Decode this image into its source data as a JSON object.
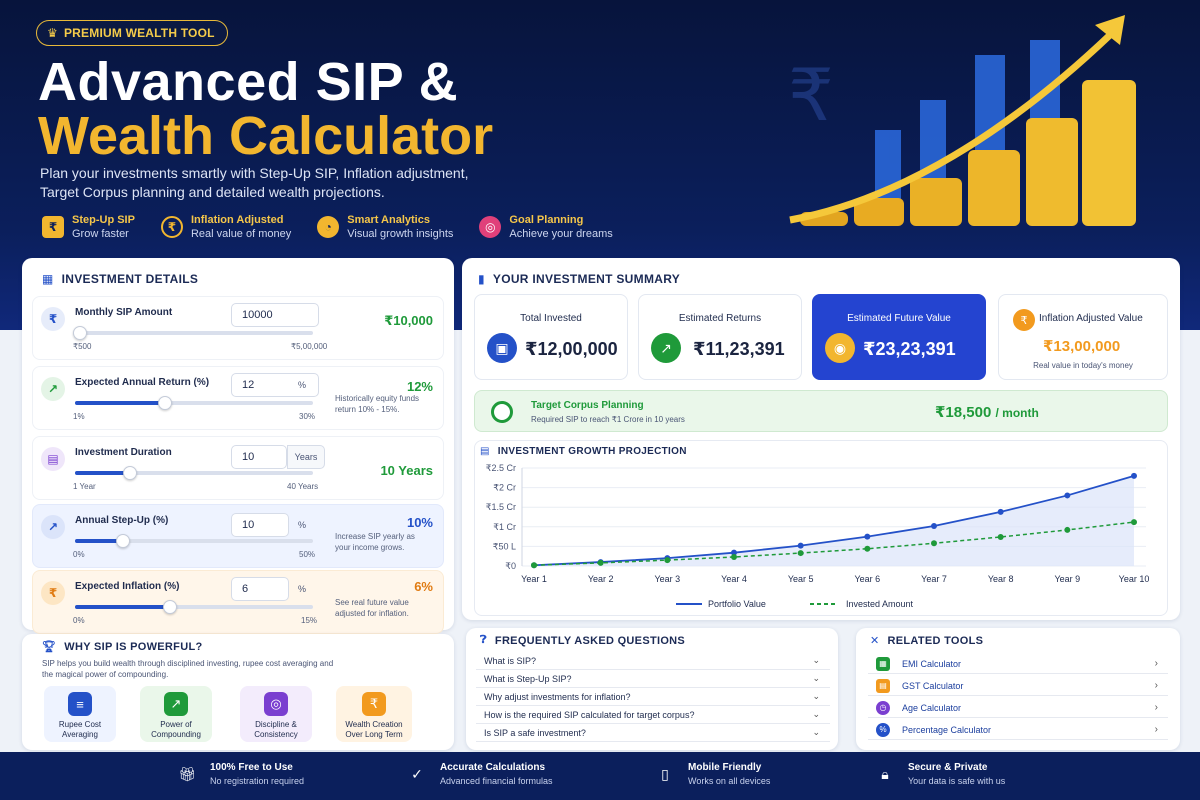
{
  "hero": {
    "badge": "PREMIUM WEALTH TOOL",
    "title_line1": "Advanced SIP &",
    "title_line2": "Wealth Calculator",
    "subtitle": "Plan your investments smartly with Step-Up SIP, Inflation adjustment, Target Corpus planning and detailed wealth projections.",
    "features": [
      {
        "title": "Step-Up SIP",
        "desc": "Grow faster"
      },
      {
        "title": "Inflation Adjusted",
        "desc": "Real value of money"
      },
      {
        "title": "Smart Analytics",
        "desc": "Visual growth insights"
      },
      {
        "title": "Goal Planning",
        "desc": "Achieve your dreams"
      }
    ]
  },
  "details": {
    "title": "INVESTMENT DETAILS",
    "rows": [
      {
        "label": "Monthly SIP Amount",
        "input": "10000",
        "unit": "",
        "min": "₹500",
        "max": "₹5,00,000",
        "value": "₹10,000",
        "note": "",
        "fraction": 0.02
      },
      {
        "label": "Expected Annual Return (%)",
        "input": "12",
        "unit": "%",
        "min": "1%",
        "max": "30%",
        "value": "12%",
        "note": "Historically equity funds return 10% - 15%.",
        "fraction": 0.38
      },
      {
        "label": "Investment Duration",
        "input": "10",
        "unit": "Years",
        "min": "1 Year",
        "max": "40 Years",
        "value": "10 Years",
        "note": "",
        "fraction": 0.23
      },
      {
        "label": "Annual Step-Up (%)",
        "input": "10",
        "unit": "%",
        "min": "0%",
        "max": "50%",
        "value": "10%",
        "note": "Increase SIP yearly as your income grows.",
        "fraction": 0.2
      },
      {
        "label": "Expected Inflation (%)",
        "input": "6",
        "unit": "%",
        "min": "0%",
        "max": "15%",
        "value": "6%",
        "note": "See real future value adjusted for inflation.",
        "fraction": 0.4
      }
    ]
  },
  "summary": {
    "title": "YOUR INVESTMENT SUMMARY",
    "cards": [
      {
        "label": "Total Invested",
        "value": "₹12,00,000"
      },
      {
        "label": "Estimated Returns",
        "value": "₹11,23,391"
      },
      {
        "label": "Estimated Future Value",
        "value": "₹23,23,391"
      },
      {
        "label": "Inflation Adjusted Value",
        "value": "₹13,00,000",
        "sub": "Real value in today's money"
      }
    ]
  },
  "target": {
    "title": "Target Corpus Planning",
    "desc": "Required SIP to reach ₹1 Crore in 10 years",
    "value": "₹18,500",
    "unit": "/ month"
  },
  "growth": {
    "title": "INVESTMENT GROWTH PROJECTION"
  },
  "chart_data": {
    "type": "line",
    "x": [
      "Year 1",
      "Year 2",
      "Year 3",
      "Year 4",
      "Year 5",
      "Year 6",
      "Year 7",
      "Year 8",
      "Year 9",
      "Year 10"
    ],
    "yticks": [
      "₹0",
      "₹50 L",
      "₹1 Cr",
      "₹1.5 Cr",
      "₹2 Cr",
      "₹2.5 Cr"
    ],
    "ylim": [
      0,
      2.5
    ],
    "yunit": "Cr",
    "series": [
      {
        "name": "Portfolio Value",
        "color": "#2451c8",
        "values": [
          0.02,
          0.1,
          0.2,
          0.34,
          0.52,
          0.75,
          1.02,
          1.38,
          1.8,
          2.3
        ]
      },
      {
        "name": "Invested Amount",
        "color": "#1f9a3a",
        "values": [
          0.02,
          0.08,
          0.15,
          0.23,
          0.33,
          0.44,
          0.58,
          0.74,
          0.92,
          1.12
        ]
      }
    ]
  },
  "faq": {
    "title": "FREQUENTLY ASKED QUESTIONS",
    "items": [
      "What is SIP?",
      "What is Step-Up SIP?",
      "Why adjust investments for inflation?",
      "How is the required SIP calculated for target corpus?",
      "Is SIP a safe investment?"
    ]
  },
  "tools": {
    "title": "RELATED TOOLS",
    "items": [
      "EMI Calculator",
      "GST Calculator",
      "Age Calculator",
      "Percentage Calculator"
    ]
  },
  "why": {
    "title": "WHY SIP IS POWERFUL?",
    "desc": "SIP helps you build wealth through disciplined investing, rupee cost averaging and the magical power of compounding.",
    "items": [
      "Rupee Cost Averaging",
      "Power of Compounding",
      "Discipline & Consistency",
      "Wealth Creation Over Long Term"
    ]
  },
  "footer": [
    {
      "title": "100% Free to Use",
      "desc": "No registration required",
      "icon": "gift-icon"
    },
    {
      "title": "Accurate Calculations",
      "desc": "Advanced financial formulas",
      "icon": "shield-check-icon"
    },
    {
      "title": "Mobile Friendly",
      "desc": "Works on all devices",
      "icon": "phone-icon"
    },
    {
      "title": "Secure & Private",
      "desc": "Your data is safe with us",
      "icon": "lock-icon"
    }
  ]
}
